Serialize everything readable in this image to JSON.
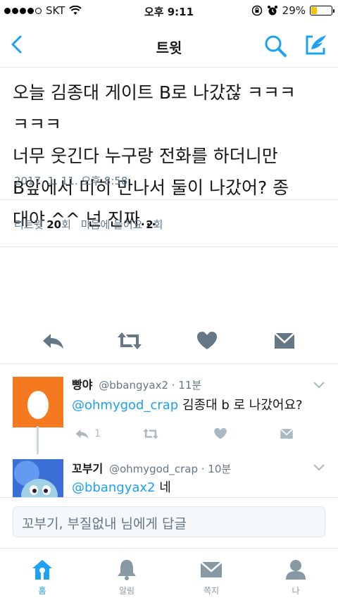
{
  "status_bar": {
    "carrier": "SKT",
    "time": "오후 9:11",
    "battery": "29%",
    "battery_level": 0.29
  },
  "nav": {
    "title": "트윗"
  },
  "tweet": {
    "text": "오늘 김종대 게이트 B로 나갔잖 ㅋㅋㅋ\nㅋㅋㅋ\n너무 웃긴다 누구랑 전화를 하더니만\nB앞에서 미히 만나서 둘이 나갔어? 종\n대야 ^^ 넌 진짜...",
    "date": "2017. 1. 11. 오후 8:58",
    "retweet_label": "리트윗",
    "retweet_count": "20",
    "retweet_unit": "회",
    "like_label": "마음에 들어요",
    "like_count": "2",
    "like_unit": "회"
  },
  "replies": [
    {
      "name": "빵야",
      "handle": "@bbangyax2",
      "time": "· 11분",
      "mention": "@ohmygod_crap",
      "text": " 김종대 b 로 나갔어요?",
      "reply_count": "1",
      "avatar_color": "#f4791f"
    },
    {
      "name": "꼬부기",
      "handle": "@ohmygod_crap",
      "time": "· 10분",
      "mention": "@bbangyax2",
      "text": " 네"
    }
  ],
  "reply_bar": {
    "placeholder": "꼬부기, 부질없내 님에게 답글"
  },
  "tabs": [
    {
      "label": "홈",
      "icon": "home-icon"
    },
    {
      "label": "알림",
      "icon": "bell-icon"
    },
    {
      "label": "쪽지",
      "icon": "envelope-icon"
    },
    {
      "label": "나",
      "icon": "person-icon"
    }
  ],
  "colors": {
    "accent": "#1da1f2",
    "muted": "#657786",
    "icon_gray": "#aab8c2"
  }
}
